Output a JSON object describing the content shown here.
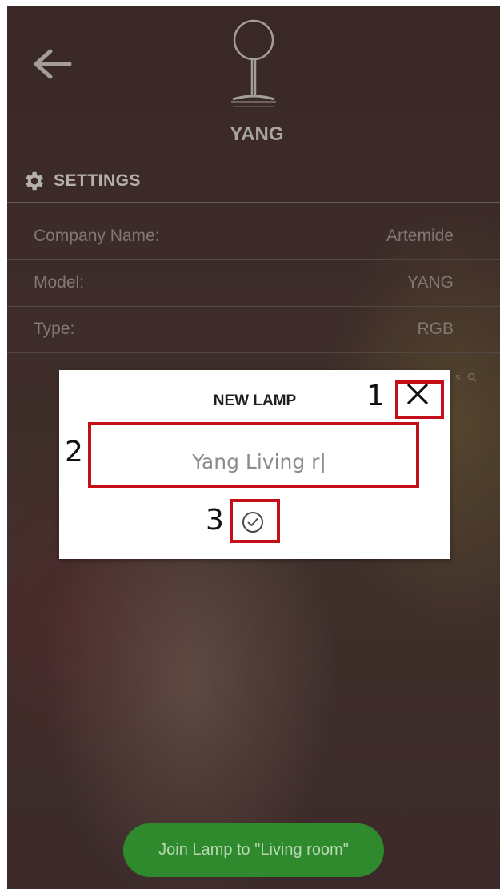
{
  "lamp": {
    "name": "YANG"
  },
  "settings": {
    "title": "SETTINGS",
    "rows": [
      {
        "label": "Company Name:",
        "value": "Artemide"
      },
      {
        "label": "Model:",
        "value": "YANG"
      },
      {
        "label": "Type:",
        "value": "RGB"
      }
    ],
    "hidden_hint": "s"
  },
  "dialog": {
    "title": "NEW LAMP",
    "input_value": "Yang Living r|"
  },
  "annotations": {
    "close": "1",
    "input": "2",
    "confirm": "3"
  },
  "footer": {
    "join_label": "Join Lamp to \"Living room\""
  },
  "colors": {
    "background": "#3d2c29",
    "annotation_red": "#c40f19",
    "join_green": "#2f8a2e",
    "dialog_bg": "#ffffff"
  },
  "icons": [
    "back-arrow-icon",
    "lamp-icon",
    "gear-icon",
    "search-icon",
    "close-icon",
    "check-circle-icon"
  ]
}
